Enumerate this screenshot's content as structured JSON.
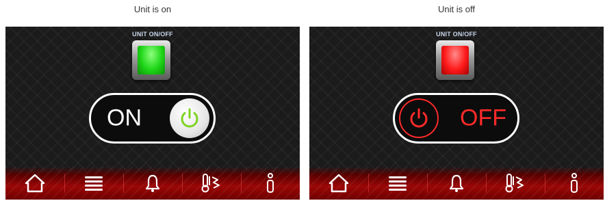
{
  "left_panel": {
    "caption": "Unit is on",
    "unit_label": "UNIT ON/OFF",
    "led_color": "#1ed617",
    "toggle_text": "ON",
    "toggle_state": "on",
    "power_icon_color": "#7ed321"
  },
  "right_panel": {
    "caption": "Unit is off",
    "unit_label": "UNIT ON/OFF",
    "led_color": "#ff1a1a",
    "toggle_text": "OFF",
    "toggle_state": "off",
    "power_icon_color": "#ff2a2a"
  },
  "navbar": {
    "color": "#9b0707",
    "icons": [
      "home-icon",
      "menu-icon",
      "bell-icon",
      "thermometer-fan-icon",
      "info-icon"
    ]
  }
}
